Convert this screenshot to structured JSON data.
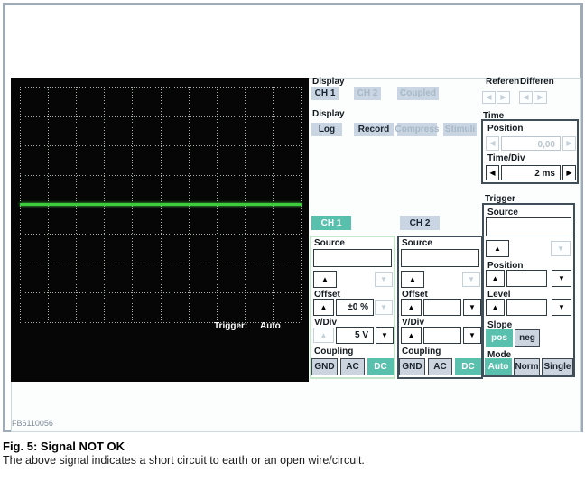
{
  "icons": {
    "up": "▲",
    "down": "▼",
    "left": "◀",
    "right": "▶"
  },
  "scope": {
    "trigger_label": "Trigger:",
    "trigger_mode": "Auto",
    "grid": {
      "cols": 10,
      "rows": 8
    },
    "trace_color": "#3ecb3e"
  },
  "display_channels": {
    "label": "Display",
    "buttons": [
      {
        "label": "CH 1"
      },
      {
        "label": "CH 2"
      },
      {
        "label": "Coupled"
      }
    ]
  },
  "display_modes": {
    "label": "Display",
    "buttons": [
      {
        "label": "Log"
      },
      {
        "label": "Record"
      },
      {
        "label": "Compress"
      },
      {
        "label": "Stimuli"
      }
    ]
  },
  "reference": {
    "label": "Referen"
  },
  "differential": {
    "label": "Differen"
  },
  "time": {
    "label": "Time",
    "position": {
      "label": "Position",
      "value": "0,00"
    },
    "time_div": {
      "label": "Time/Div",
      "value": "2 ms"
    }
  },
  "channels": [
    {
      "tab": "CH 1",
      "source_label": "Source",
      "source_value": "",
      "offset_label": "Offset",
      "offset_value": "±0 %",
      "vdiv_label": "V/Div",
      "vdiv_value": "5 V",
      "coupling_label": "Coupling",
      "coupling": [
        "GND",
        "AC",
        "DC"
      ],
      "coupling_selected": "DC"
    },
    {
      "tab": "CH 2",
      "source_label": "Source",
      "source_value": "",
      "offset_label": "Offset",
      "offset_value": "",
      "vdiv_label": "V/Div",
      "vdiv_value": "",
      "coupling_label": "Coupling",
      "coupling": [
        "GND",
        "AC",
        "DC"
      ],
      "coupling_selected": "DC"
    }
  ],
  "trigger": {
    "label": "Trigger",
    "source_label": "Source",
    "source_value": "",
    "position_label": "Position",
    "position_value": "",
    "level_label": "Level",
    "level_value": "",
    "slope_label": "Slope",
    "slope": [
      "pos",
      "neg"
    ],
    "slope_selected": "pos",
    "mode_label": "Mode",
    "modes": [
      "Auto",
      "Norm",
      "Single"
    ],
    "mode_selected": "Auto"
  },
  "footer_code": "FB6110056",
  "caption": {
    "title": "Fig. 5: Signal NOT OK",
    "text": "The above signal indicates a short circuit to earth or an open wire/circuit."
  }
}
